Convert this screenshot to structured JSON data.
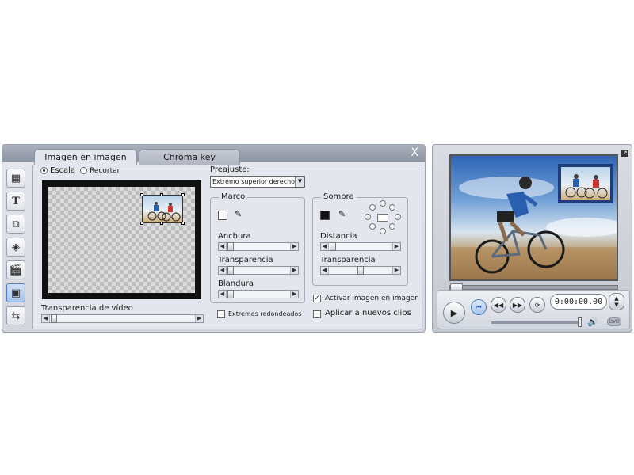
{
  "tabs": {
    "active": "Imagen en imagen",
    "inactive": "Chroma key",
    "close": "X"
  },
  "toolbar": {
    "tools": [
      {
        "icon": "scene-icon"
      },
      {
        "icon": "title-icon",
        "glyph": "T"
      },
      {
        "icon": "transition-icon"
      },
      {
        "icon": "effects-icon"
      },
      {
        "icon": "clapboard-icon"
      },
      {
        "icon": "picture-in-picture-icon"
      },
      {
        "icon": "audio-icon"
      }
    ]
  },
  "mode": {
    "scale_label": "Escala",
    "crop_label": "Recortar",
    "selected": "Escala"
  },
  "video_transparency": {
    "label": "Transparencia de vídeo"
  },
  "preset": {
    "label": "Preajuste:",
    "value": "Extremo superior derecho"
  },
  "frame": {
    "title": "Marco",
    "width_label": "Anchura",
    "transparency_label": "Transparencia",
    "softness_label": "Blandura",
    "rounded_label": "Extremos redondeados"
  },
  "shadow": {
    "title": "Sombra",
    "distance_label": "Distancia",
    "transparency_label": "Transparencia"
  },
  "options": {
    "enable_pip": "Activar imagen en imagen",
    "enable_pip_checked": true,
    "apply_new_clips": "Aplicar a nuevos clips",
    "apply_new_clips_checked": false
  },
  "player": {
    "timecode": "0:00:00.00",
    "dvd_label": "DVD"
  },
  "colors": {
    "accent": "#4f7cc4",
    "panel": "#e3e6ec"
  }
}
